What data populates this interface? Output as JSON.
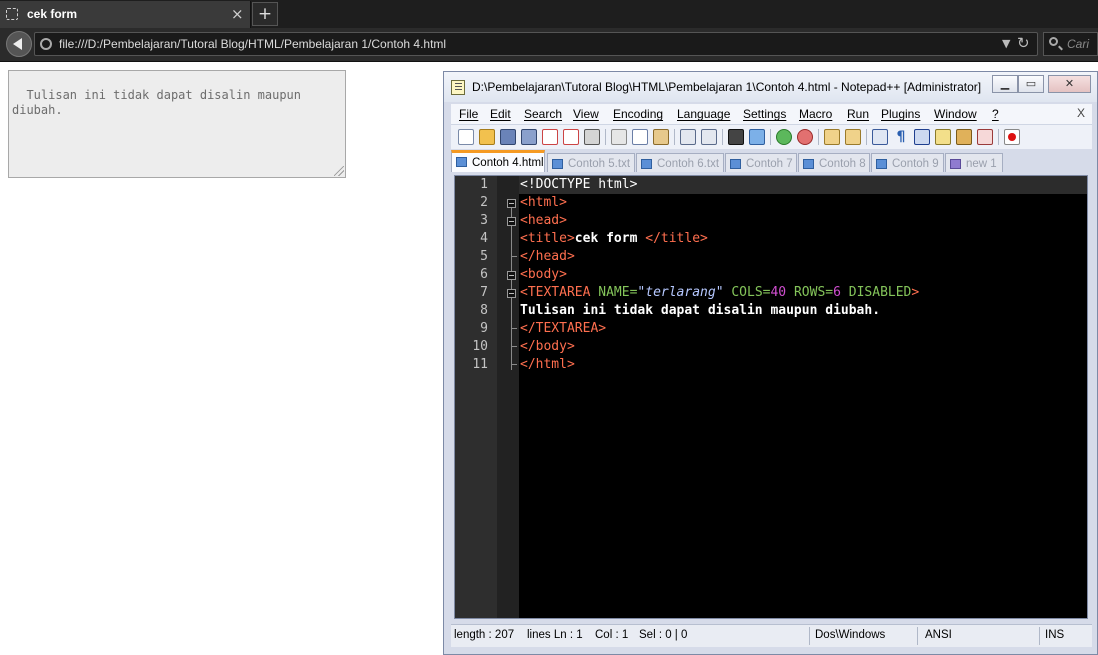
{
  "browser": {
    "tab_title": "cek form",
    "tab_close": "×",
    "new_tab": "+",
    "url": "file:///D:/Pembelajaran/Tutoral Blog/HTML/Pembelajaran 1/Contoh 4.html",
    "url_dropdown": "▼",
    "reload": "↻",
    "search_placeholder": "Cari"
  },
  "page": {
    "textarea_value": "Tulisan ini tidak dapat disalin maupun diubah."
  },
  "npp": {
    "title": "D:\\Pembelajaran\\Tutoral Blog\\HTML\\Pembelajaran 1\\Contoh 4.html - Notepad++ [Administrator]",
    "min": "▁",
    "max": "▭",
    "close": "✕",
    "menu": [
      "File",
      "Edit",
      "Search",
      "View",
      "Encoding",
      "Language",
      "Settings",
      "Macro",
      "Run",
      "Plugins",
      "Window",
      "?"
    ],
    "menu_close": "X",
    "tabs": [
      "Contoh 4.html",
      "Contoh 5.txt",
      "Contoh 6.txt",
      "Contoh 7",
      "Contoh 8",
      "Contoh 9",
      "new 1"
    ],
    "line_numbers": [
      "1",
      "2",
      "3",
      "4",
      "5",
      "6",
      "7",
      "8",
      "9",
      "10",
      "11"
    ],
    "code": {
      "l1": "<!DOCTYPE html>",
      "l2": "<html>",
      "l3": "<head>",
      "l4_open": "<title>",
      "l4_text": "cek form ",
      "l4_close": "</title>",
      "l5": "</head>",
      "l6": "<body>",
      "l7_tag": "<TEXTAREA ",
      "l7_name": "NAME=",
      "l7_nameval": "\"terlarang\"",
      "l7_cols": " COLS=",
      "l7_colsval": "40",
      "l7_rows": " ROWS=",
      "l7_rowsval": "6",
      "l7_dis": " DISABLED",
      "l7_end": ">",
      "l8": "Tulisan ini tidak dapat disalin maupun diubah.",
      "l9": "</TEXTAREA>",
      "l10": "</body>",
      "l11": "</html>"
    },
    "status": {
      "length": "length : 207",
      "lines": "lines Ln : 1",
      "col": "Col : 1",
      "sel": "Sel : 0 | 0",
      "eol": "Dos\\Windows",
      "encoding": "ANSI",
      "mode": "INS"
    }
  }
}
